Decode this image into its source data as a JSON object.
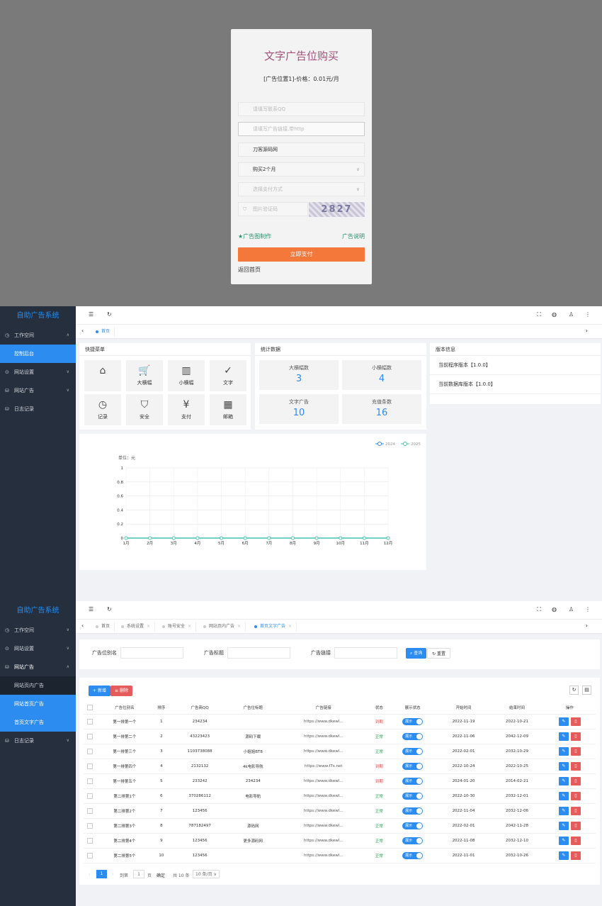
{
  "purchase": {
    "title": "文字广告位购买",
    "subtitle": "[广告位置1]-价格：0.01元/月",
    "qq_placeholder": "请填写联系QQ",
    "link_placeholder": "请填写广告链接,带http",
    "name_value": "刀客源码网",
    "duration_value": "购买2个月",
    "pay_method_placeholder": "选择支付方式",
    "captcha_placeholder": "图片验证码",
    "captcha_text": "2827",
    "ad_image_link": "★广告图制作",
    "ad_help_link": "广告说明",
    "pay_button": "立即支付",
    "back_link": "返回首页"
  },
  "admin1": {
    "brand": "自助广告系统",
    "menu": [
      {
        "label": "工作空间",
        "icon": "◷",
        "chevron": "∧"
      },
      {
        "label": "控制后台",
        "sub": true,
        "active": true
      },
      {
        "label": "网站设置",
        "icon": "⊙",
        "chevron": "∨"
      },
      {
        "label": "网站广告",
        "icon": "⛁",
        "chevron": "∨"
      },
      {
        "label": "日志记录",
        "icon": "⛁"
      }
    ],
    "tabs": [
      {
        "label": "首页",
        "active": true
      }
    ],
    "quick_title": "快捷菜单",
    "quick": [
      {
        "label": "",
        "icon": "⌂"
      },
      {
        "label": "大横幅",
        "icon": "🛒"
      },
      {
        "label": "小横幅",
        "icon": "▥"
      },
      {
        "label": "文字",
        "icon": "✓"
      },
      {
        "label": "记录",
        "icon": "◷"
      },
      {
        "label": "安全",
        "icon": "⛉"
      },
      {
        "label": "支付",
        "icon": "¥"
      },
      {
        "label": "邮箱",
        "icon": "▦"
      }
    ],
    "stats_title": "统计数据",
    "stats": [
      {
        "label": "大横幅数",
        "value": "3"
      },
      {
        "label": "小横幅数",
        "value": "4"
      },
      {
        "label": "文字广告",
        "value": "10"
      },
      {
        "label": "充值条数",
        "value": "16"
      }
    ],
    "version_title": "版本信息",
    "versions": [
      "当前程序版本【1.0.0】",
      "当前数据库版本【1.0.0】"
    ]
  },
  "chart_data": {
    "type": "line",
    "ylabel": "单位：元",
    "categories": [
      "1月",
      "2月",
      "3月",
      "4月",
      "5月",
      "6月",
      "7月",
      "8月",
      "9月",
      "10月",
      "11月",
      "12月"
    ],
    "ylim": [
      0,
      1
    ],
    "yticks": [
      "0",
      "0.2",
      "0.4",
      "0.6",
      "0.8",
      "1"
    ],
    "series": [
      {
        "name": "2024",
        "values": [
          0,
          0,
          0,
          0,
          0,
          0,
          0,
          0,
          0,
          0,
          0,
          0
        ],
        "color": "#2d8cf0"
      },
      {
        "name": "2025",
        "values": [
          0,
          0,
          0,
          0,
          0,
          0,
          0,
          0,
          0,
          0,
          0,
          0
        ],
        "color": "#3cc9a3"
      }
    ],
    "legend": "top-right",
    "grid": true
  },
  "admin2": {
    "brand": "自助广告系统",
    "menu": [
      {
        "label": "工作空间",
        "icon": "◷",
        "chevron": "∨"
      },
      {
        "label": "网站设置",
        "icon": "⊙",
        "chevron": "∨"
      },
      {
        "label": "网站广告",
        "icon": "⛁",
        "chevron": "∧",
        "bold": true
      },
      {
        "label": "网站页内广告",
        "sub": true
      },
      {
        "label": "网站首页广告",
        "sub": true,
        "active": true
      },
      {
        "label": "首页文字广告",
        "sub": true,
        "active": true
      },
      {
        "label": "日志记录",
        "icon": "⛁",
        "chevron": "∨"
      }
    ],
    "tabs": [
      {
        "label": "首页"
      },
      {
        "label": "系统设置"
      },
      {
        "label": "账号安全"
      },
      {
        "label": "网站页内广告"
      },
      {
        "label": "首页文字广告",
        "active": true
      }
    ],
    "search": {
      "name_label": "广告位别名",
      "title_label": "广告标题",
      "link_label": "广告链接",
      "search_btn": "查询",
      "reset_btn": "重置"
    },
    "add_btn": "新增",
    "del_btn": "删除",
    "columns": [
      "广告位别名",
      "排序",
      "广告商QQ",
      "广告位标题",
      "广告链接",
      "状态",
      "展示状态",
      "开始时间",
      "结束时间",
      "操作"
    ],
    "rows": [
      {
        "name": "第一排第一个",
        "sort": "1",
        "qq": "234234",
        "title": "",
        "link": "https://www.dkewl...",
        "status": "到期",
        "show": "展示",
        "start": "2022-11-19",
        "end": "2022-10-21"
      },
      {
        "name": "第一排第二个",
        "sort": "2",
        "qq": "43223423",
        "title": "源码下载",
        "link": "https://www.dkewl...",
        "status": "正常",
        "show": "展示",
        "start": "2022-11-06",
        "end": "2042-12-09"
      },
      {
        "name": "第一排第三个",
        "sort": "3",
        "qq": "1103738088",
        "title": "小姐姐BT8",
        "link": "https://www.dkewl...",
        "status": "正常",
        "show": "展示",
        "start": "2022-02-01",
        "end": "2032-10-29"
      },
      {
        "name": "第一排第四个",
        "sort": "4",
        "qq": "2132132",
        "title": "4k电影导航",
        "link": "https://www.f7s.net",
        "status": "到期",
        "show": "展示",
        "start": "2022-10-24",
        "end": "2022-10-25"
      },
      {
        "name": "第一排第五个",
        "sort": "5",
        "qq": "233242",
        "title": "234234",
        "link": "https://www.dkewl...",
        "status": "到期",
        "show": "展示",
        "start": "2024-01-20",
        "end": "2014-02-21"
      },
      {
        "name": "第二排第1个",
        "sort": "6",
        "qq": "370286112",
        "title": "电影导航",
        "link": "https://www.dkewl...",
        "status": "正常",
        "show": "展示",
        "start": "2022-10-30",
        "end": "2032-12-01"
      },
      {
        "name": "第二排第2个",
        "sort": "7",
        "qq": "123456",
        "title": "",
        "link": "https://www.dkewl...",
        "status": "正常",
        "show": "展示",
        "start": "2022-11-04",
        "end": "2032-12-06"
      },
      {
        "name": "第二排第3个",
        "sort": "8",
        "qq": "787182497",
        "title": "源码网",
        "link": "https://www.dkewl...",
        "status": "正常",
        "show": "展示",
        "start": "2022-02-01",
        "end": "2042-11-28"
      },
      {
        "name": "第二排第4个",
        "sort": "9",
        "qq": "123456",
        "title": "更多源码网",
        "link": "https://www.dkewl...",
        "status": "正常",
        "show": "展示",
        "start": "2022-11-08",
        "end": "2032-12-10"
      },
      {
        "name": "第二排第5个",
        "sort": "10",
        "qq": "123456",
        "title": "",
        "link": "https://www.dkewl...",
        "status": "正常",
        "show": "展示",
        "start": "2022-11-01",
        "end": "2032-10-26"
      }
    ],
    "pager": {
      "page": "1",
      "goto": "到第",
      "page_input": "1",
      "page_unit": "页",
      "ok": "确定",
      "total": "共 10 条",
      "size": "10 条/页"
    }
  }
}
